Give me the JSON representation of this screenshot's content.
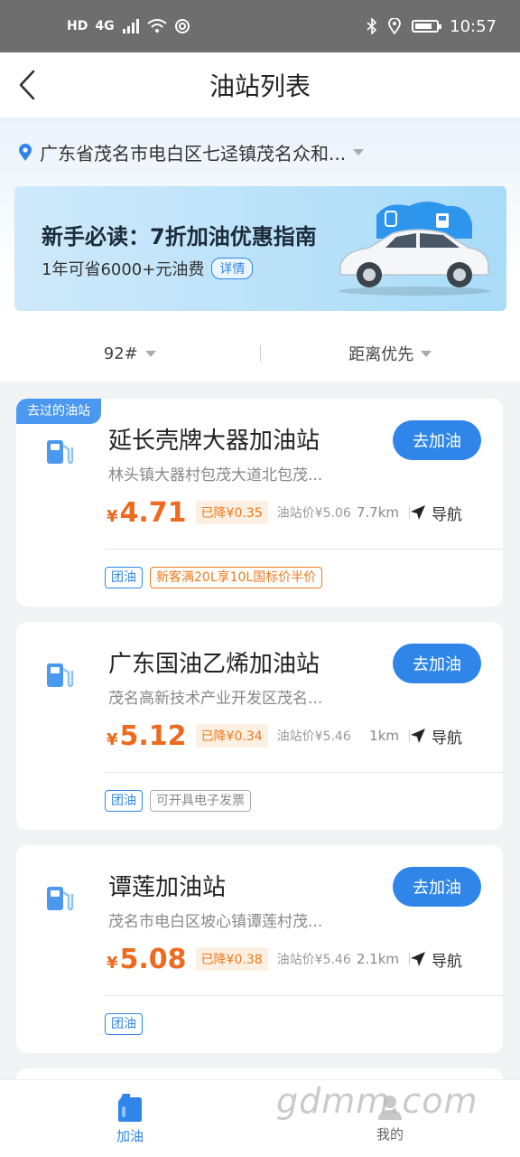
{
  "status_bar": {
    "left_labels": [
      "HD",
      "4G"
    ],
    "time": "10:57"
  },
  "header": {
    "title": "油站列表",
    "back_icon": "chevron-left-icon"
  },
  "location": {
    "text": "广东省茂名市电白区七迳镇茂名众和..."
  },
  "banner": {
    "title": "新手必读：7折加油优惠指南",
    "subtitle": "1年可省6000+元油费",
    "detail_label": "详情"
  },
  "filters": {
    "fuel_grade": "92#",
    "sort": "距离优先"
  },
  "stations": [
    {
      "visited_tag": "去过的油站",
      "name": "延长壳牌大器加油站",
      "address": "林头镇大器村包茂大道北包茂...",
      "go_label": "去加油",
      "yen": "¥",
      "price": "4.71",
      "drop": "已降¥0.35",
      "station_price": "油站价¥5.06",
      "distance": "7.7km",
      "nav_label": "导航",
      "tags": [
        {
          "text": "团油",
          "style": "blue"
        },
        {
          "text": "新客满20L享10L国标价半价",
          "style": "orange"
        }
      ]
    },
    {
      "visited_tag": "",
      "name": "广东国油乙烯加油站",
      "address": "茂名高新技术产业开发区茂名...",
      "go_label": "去加油",
      "yen": "¥",
      "price": "5.12",
      "drop": "已降¥0.34",
      "station_price": "油站价¥5.46",
      "distance": "1km",
      "nav_label": "导航",
      "tags": [
        {
          "text": "团油",
          "style": "blue"
        },
        {
          "text": "可开具电子发票",
          "style": "gray"
        }
      ]
    },
    {
      "visited_tag": "",
      "name": "谭莲加油站",
      "address": "茂名市电白区坡心镇谭莲村茂...",
      "go_label": "去加油",
      "yen": "¥",
      "price": "5.08",
      "drop": "已降¥0.38",
      "station_price": "油站价¥5.46",
      "distance": "2.1km",
      "nav_label": "导航",
      "tags": [
        {
          "text": "团油",
          "style": "blue"
        }
      ]
    }
  ],
  "bottom_nav": {
    "items": [
      {
        "label": "加油",
        "icon": "fuel-can-icon",
        "active": true
      },
      {
        "label": "我的",
        "icon": "user-icon",
        "active": false
      }
    ]
  },
  "watermark": "gdmm.com",
  "colors": {
    "accent": "#2f86e8",
    "price": "#ee6a1e",
    "status_bar": "#6e6e6e"
  }
}
